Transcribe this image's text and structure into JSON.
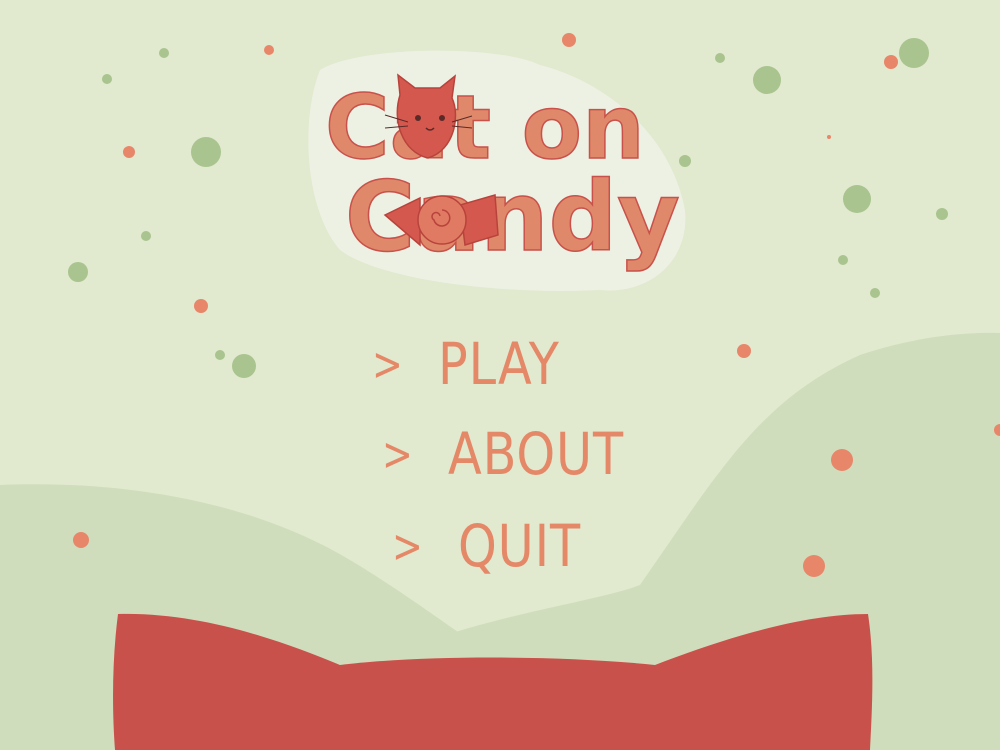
{
  "game": {
    "title_line1": "Cat on",
    "title_line2": "Candy"
  },
  "menu": {
    "items": [
      {
        "arrow": ">",
        "label": "PLAY"
      },
      {
        "arrow": ">",
        "label": "ABOUT"
      },
      {
        "arrow": ">",
        "label": "QUIT"
      }
    ]
  },
  "colors": {
    "background": "#e1e9cf",
    "hill": "#cfddbc",
    "accent": "#e48868",
    "bow": "#c8524b",
    "green_dot": "#a9c48f",
    "orange_dot": "#e8866a"
  }
}
